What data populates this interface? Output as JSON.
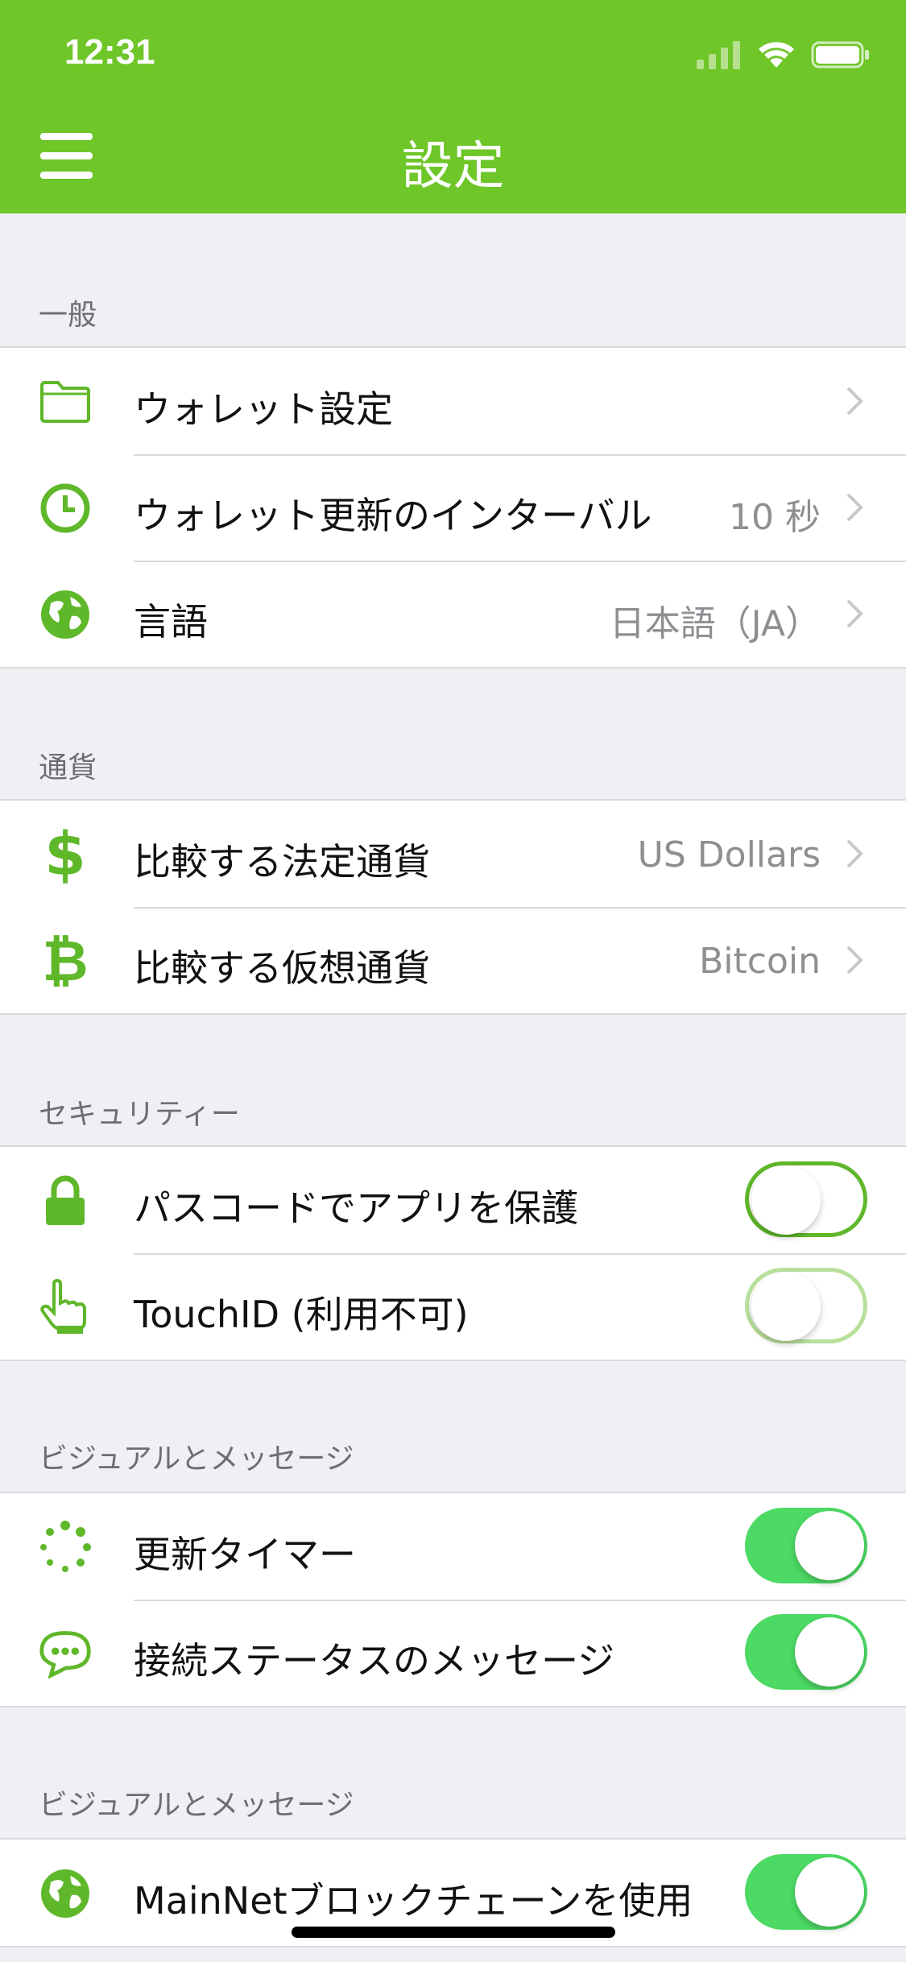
{
  "status_bar": {
    "time": "12:31"
  },
  "nav": {
    "title": "設定"
  },
  "sections": {
    "general": {
      "header": "一般",
      "rows": [
        {
          "label": "ウォレット設定",
          "value": ""
        },
        {
          "label": "ウォレット更新のインターバル",
          "value": "10 秒"
        },
        {
          "label": "言語",
          "value": "日本語（JA）"
        }
      ]
    },
    "currency": {
      "header": "通貨",
      "rows": [
        {
          "label": "比較する法定通貨",
          "value": "US Dollars"
        },
        {
          "label": "比較する仮想通貨",
          "value": "Bitcoin"
        }
      ]
    },
    "security": {
      "header": "セキュリティー",
      "rows": [
        {
          "label": "パスコードでアプリを保護",
          "toggle": "off"
        },
        {
          "label": "TouchID (利用不可)",
          "toggle": "off-disabled"
        }
      ]
    },
    "visual": {
      "header": "ビジュアルとメッセージ",
      "rows": [
        {
          "label": "更新タイマー",
          "toggle": "on"
        },
        {
          "label": "接続ステータスのメッセージ",
          "toggle": "on"
        }
      ]
    },
    "visual2": {
      "header": "ビジュアルとメッセージ",
      "rows": [
        {
          "label": "MainNetブロックチェーンを使用",
          "toggle": "on"
        }
      ]
    }
  },
  "colors": {
    "accent": "#6ec628",
    "toggle_on": "#4cd964",
    "background": "#efeff4"
  }
}
